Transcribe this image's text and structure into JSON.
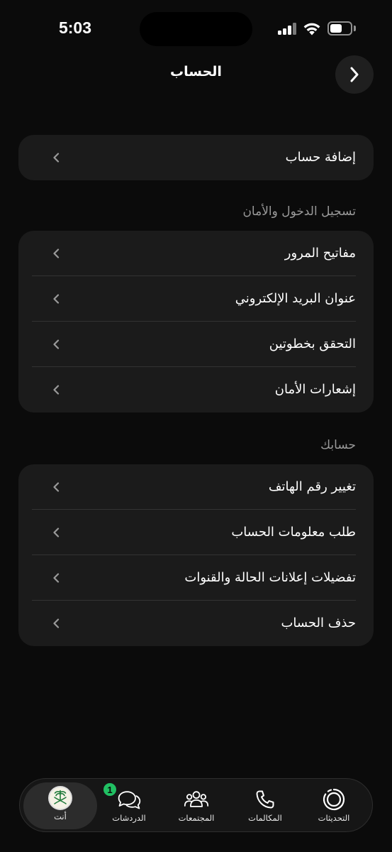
{
  "status_bar": {
    "time": "5:03"
  },
  "header": {
    "title": "الحساب"
  },
  "cards": {
    "add_account": {
      "label": "إضافة حساب"
    },
    "security": {
      "title": "تسجيل الدخول والأمان",
      "items": [
        {
          "label": "مفاتيح المرور"
        },
        {
          "label": "عنوان البريد الإلكتروني"
        },
        {
          "label": "التحقق بخطوتين"
        },
        {
          "label": "إشعارات الأمان"
        }
      ]
    },
    "your_account": {
      "title": "حسابك",
      "items": [
        {
          "label": "تغيير رقم الهاتف"
        },
        {
          "label": "طلب معلومات الحساب"
        },
        {
          "label": "تفضيلات إعلانات الحالة والقنوات"
        },
        {
          "label": "حذف الحساب"
        }
      ]
    }
  },
  "tab_bar": {
    "tabs": [
      {
        "label": "التحديثات",
        "icon": "updates-icon"
      },
      {
        "label": "المكالمات",
        "icon": "phone-icon"
      },
      {
        "label": "المجتمعات",
        "icon": "communities-icon"
      },
      {
        "label": "الدردشات",
        "icon": "chats-icon",
        "badge": "1"
      },
      {
        "label": "أنت",
        "icon": "avatar",
        "active": true
      }
    ]
  },
  "colors": {
    "background": "#0b0b0b",
    "card": "#1b1b1b",
    "badge": "#21c063",
    "section_header": "#9a9a9a"
  }
}
